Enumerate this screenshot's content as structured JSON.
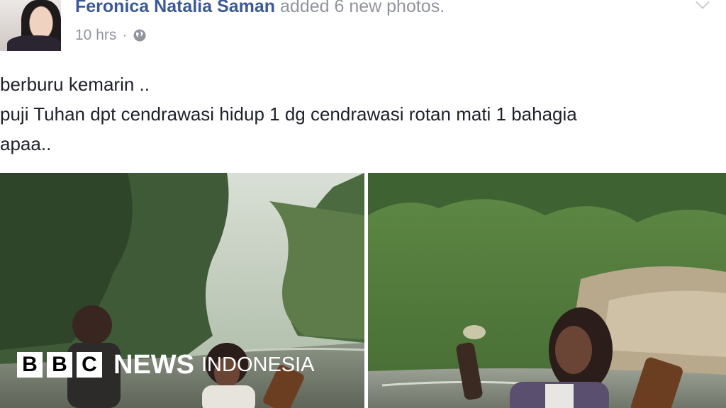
{
  "post": {
    "author": "Feronica Natalia Saman",
    "action": "added 6 new photos.",
    "timestamp": "10 hrs",
    "separator": "·",
    "privacy_icon": "globe-icon",
    "text_lines": [
      "berburu kemarin ..",
      "puji Tuhan dpt cendrawasi hidup 1 dg cendrawasi rotan mati 1 bahagia",
      "apaa.."
    ],
    "link_color": "#3b5998",
    "meta_color": "#90949c"
  },
  "watermark": {
    "letters": [
      "B",
      "B",
      "C"
    ],
    "brand": "NEWS",
    "language": "INDONESIA"
  }
}
